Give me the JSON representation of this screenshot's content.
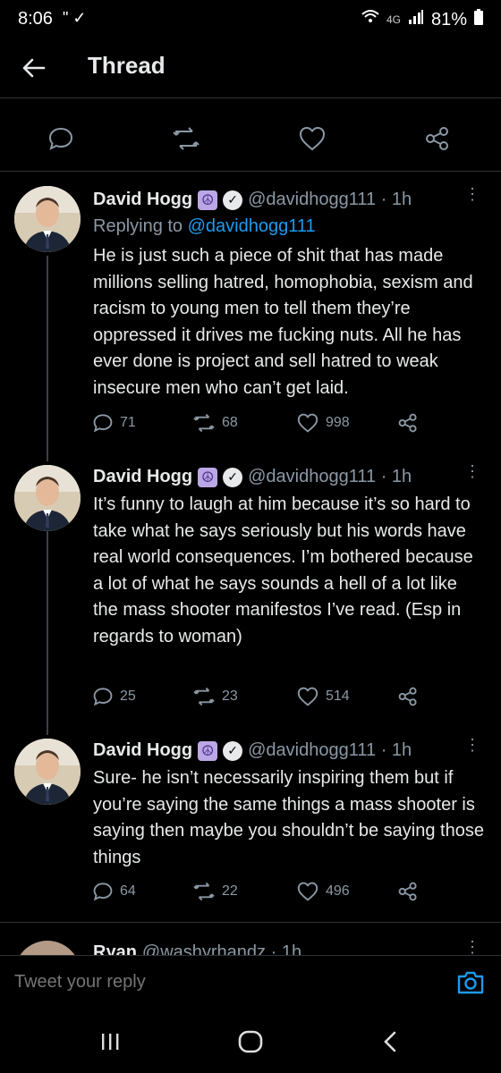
{
  "status_bar": {
    "time": "8:06",
    "left_icons": "\" ✓",
    "network": "4G",
    "battery": "81%"
  },
  "header": {
    "title": "Thread"
  },
  "action_icons": [
    "reply-icon",
    "retweet-icon",
    "like-icon",
    "share-icon"
  ],
  "tweets": [
    {
      "name": "David Hogg",
      "handle": "@davidhogg111 · 1h",
      "replying_label": "Replying to",
      "replying_to": "@davidhogg111",
      "text": "He is just such a piece of shit that has made millions selling hatred, homophobia, sexism and racism to young men to tell them they’re oppressed it drives me fucking nuts. All he has ever done is project and sell hatred to weak insecure men who can’t get laid.",
      "replies": "71",
      "retweets": "68",
      "likes": "998"
    },
    {
      "name": "David Hogg",
      "handle": "@davidhogg111 · 1h",
      "text": "It’s funny to laugh at him because it’s so hard to take what he says seriously but his words have real world consequences. I’m bothered because a lot of what he says sounds a hell of a lot like the mass shooter manifestos I’ve read. (Esp in regards to woman)",
      "replies": "25",
      "retweets": "23",
      "likes": "514"
    },
    {
      "name": "David Hogg",
      "handle": "@davidhogg111 · 1h",
      "text": "Sure- he isn’t necessarily inspiring them but if you’re saying the same things a mass shooter is saying then maybe you shouldn’t be saying those things",
      "replies": "64",
      "retweets": "22",
      "likes": "496"
    }
  ],
  "partial_tweet": {
    "name": "Ryan",
    "handle": "@washyrhandz · 1h"
  },
  "reply_bar": {
    "placeholder": "Tweet your reply"
  },
  "colors": {
    "background": "#000000",
    "text": "#e7e9ea",
    "muted": "#8b98a5",
    "link": "#1d9bf0",
    "divider": "#2f3336"
  }
}
